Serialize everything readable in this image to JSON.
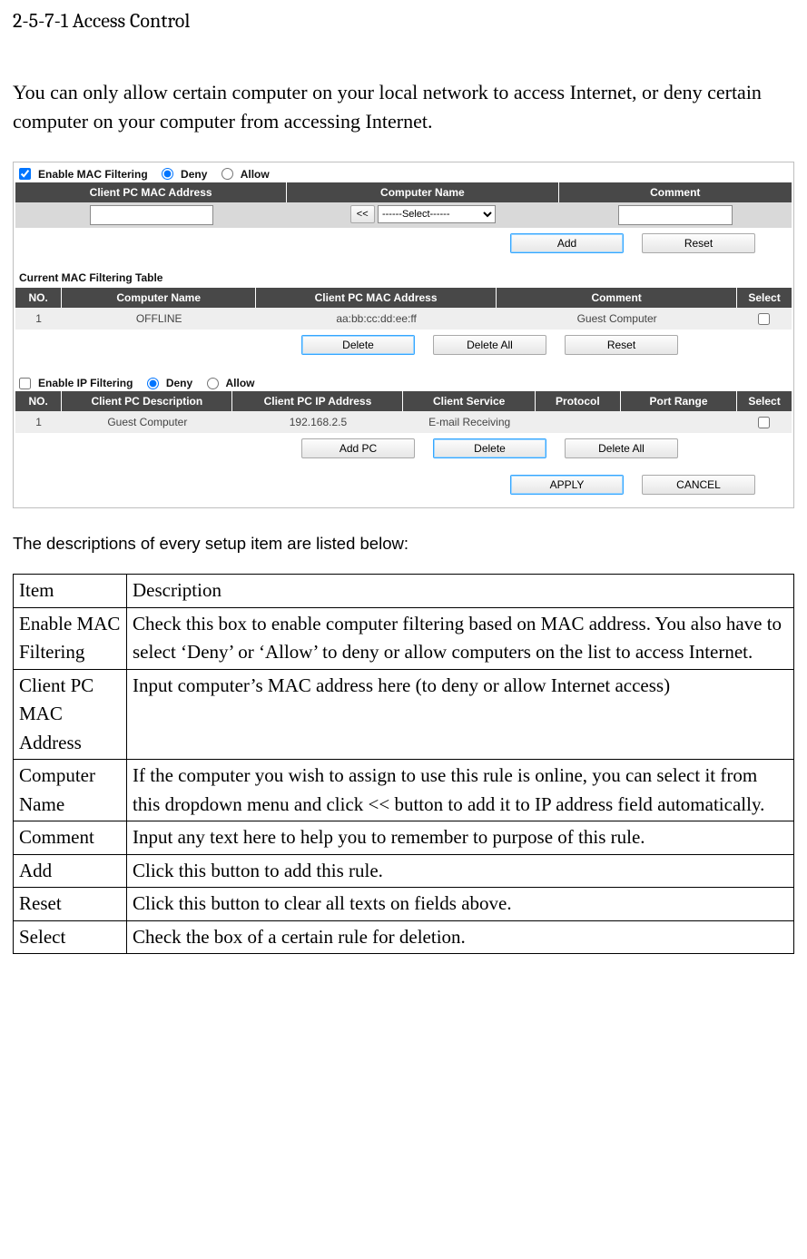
{
  "heading": "2-5-7-1 Access Control",
  "intro": "You can only allow certain computer on your local network to access Internet, or deny certain computer on your computer from accessing Internet.",
  "screenshot": {
    "macFilter": {
      "enableLabel": "Enable MAC Filtering",
      "denyLabel": "Deny",
      "allowLabel": "Allow",
      "headers": {
        "mac": "Client PC MAC Address",
        "name": "Computer Name",
        "comment": "Comment"
      },
      "copyBtn": "<<",
      "selectPlaceholder": "------Select------",
      "addBtn": "Add",
      "resetBtn": "Reset"
    },
    "currentTable": {
      "title": "Current MAC Filtering Table",
      "headers": {
        "no": "NO.",
        "name": "Computer Name",
        "mac": "Client PC MAC Address",
        "comment": "Comment",
        "select": "Select"
      },
      "row": {
        "no": "1",
        "name": "OFFLINE",
        "mac": "aa:bb:cc:dd:ee:ff",
        "comment": "Guest Computer"
      },
      "deleteBtn": "Delete",
      "deleteAllBtn": "Delete All",
      "resetBtn": "Reset"
    },
    "ipFilter": {
      "enableLabel": "Enable IP Filtering",
      "denyLabel": "Deny",
      "allowLabel": "Allow",
      "headers": {
        "no": "NO.",
        "desc": "Client PC Description",
        "ip": "Client PC IP Address",
        "service": "Client Service",
        "proto": "Protocol",
        "port": "Port Range",
        "select": "Select"
      },
      "row": {
        "no": "1",
        "desc": "Guest Computer",
        "ip": "192.168.2.5",
        "service": "E-mail Receiving",
        "proto": "",
        "port": ""
      },
      "addPcBtn": "Add PC",
      "deleteBtn": "Delete",
      "deleteAllBtn": "Delete All"
    },
    "footer": {
      "apply": "APPLY",
      "cancel": "CANCEL"
    }
  },
  "descIntro": "The descriptions of every setup item are listed below:",
  "descTable": {
    "header": {
      "item": "Item",
      "desc": "Description"
    },
    "rows": [
      {
        "item": "Enable MAC Filtering",
        "desc": "Check this box to enable computer filtering based on MAC address. You also have to select ‘Deny’ or ‘Allow’ to deny or allow computers on the list to access Internet."
      },
      {
        "item": "Client PC MAC Address",
        "desc": "Input computer’s MAC address here (to deny or allow Internet access)"
      },
      {
        "item": "Computer Name",
        "desc": "If the computer you wish to assign to use this rule is online, you can select it from this dropdown menu and click << button to add it to IP address field automatically."
      },
      {
        "item": "Comment",
        "desc": "Input any text here to help you to remember to purpose of this rule."
      },
      {
        "item": "Add",
        "desc": "Click this button to add this rule."
      },
      {
        "item": "Reset",
        "desc": "Click this button to clear all texts on fields above."
      },
      {
        "item": "Select",
        "desc": "Check the box of a certain rule for deletion."
      }
    ]
  }
}
